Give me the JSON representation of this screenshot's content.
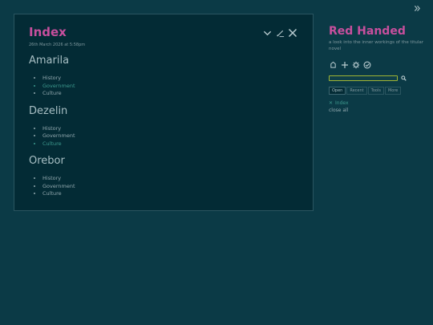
{
  "story_menu": {
    "icon": "chevron-double-right-icon"
  },
  "tiddler": {
    "title": "Index",
    "subtitle": "26th March 2026 at 5:58pm",
    "controls": [
      {
        "name": "more-options",
        "icon": "chevron-down-icon"
      },
      {
        "name": "edit",
        "icon": "pencil-icon"
      },
      {
        "name": "close",
        "icon": "close-icon"
      }
    ],
    "sections": [
      {
        "heading": "Amarila",
        "items": [
          {
            "label": "History",
            "active": false
          },
          {
            "label": "Government",
            "active": true
          },
          {
            "label": "Culture",
            "active": false
          }
        ]
      },
      {
        "heading": "Dezelin",
        "items": [
          {
            "label": "History",
            "active": false
          },
          {
            "label": "Government",
            "active": false
          },
          {
            "label": "Culture",
            "active": true
          }
        ]
      },
      {
        "heading": "Orebor",
        "items": [
          {
            "label": "History",
            "active": false
          },
          {
            "label": "Government",
            "active": false
          },
          {
            "label": "Culture",
            "active": false
          }
        ]
      }
    ]
  },
  "sidebar": {
    "title": "Red Handed",
    "subtitle": "a look into the inner workings of the titular novel",
    "page_controls": [
      {
        "name": "home",
        "icon": "home-icon"
      },
      {
        "name": "new-tiddler",
        "icon": "plus-icon"
      },
      {
        "name": "control-panel",
        "icon": "gear-icon"
      },
      {
        "name": "save",
        "icon": "check-circle-icon"
      }
    ],
    "search": {
      "value": "",
      "placeholder": "",
      "icon": "search-icon"
    },
    "tabs": [
      {
        "label": "Open",
        "selected": true
      },
      {
        "label": "Recent",
        "selected": false
      },
      {
        "label": "Tools",
        "selected": false
      },
      {
        "label": "More",
        "selected": false
      }
    ],
    "open_items": [
      {
        "label": "Index"
      }
    ],
    "close_all": "close all"
  },
  "colors": {
    "background": "#0b3a46",
    "card": "#032b35",
    "accent_title": "#c74f9d",
    "link": "#3d9a8e",
    "search_border": "#a0b534"
  }
}
